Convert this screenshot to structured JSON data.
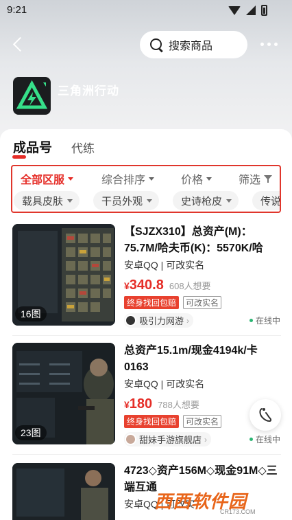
{
  "status_bar": {
    "time": "9:21"
  },
  "header": {
    "search_placeholder": "搜索商品",
    "game_title": "三角洲行动"
  },
  "tabs": [
    {
      "label": "成品号"
    },
    {
      "label": "代练"
    }
  ],
  "sort_bar": {
    "region": "全部区服",
    "sort": "综合排序",
    "price": "价格",
    "filter": "筛选"
  },
  "filter_chips": [
    "载具皮肤",
    "干员外观",
    "史诗枪皮",
    "传说枪"
  ],
  "listings": [
    {
      "title": "【SJZX310】总资产(M)：75.7M/哈夫币(K)：5570K/哈",
      "subtitle": "安卓QQ | 可改实名",
      "currency": "¥",
      "price": "340.8",
      "wants": "608人想要",
      "badge_guarantee": "终身找回包赔",
      "badge_realname": "可改实名",
      "shop": "吸引力网游",
      "status": "在线中",
      "image_count": "16图"
    },
    {
      "title": "总资产15.1m/现金4194k/卡0163",
      "subtitle": "安卓QQ | 可改实名",
      "currency": "¥",
      "price": "180",
      "wants": "788人想要",
      "badge_guarantee": "终身找回包赔",
      "badge_realname": "可改实名",
      "shop": "甜妹手游旗舰店",
      "status": "在线中",
      "image_count": "23图"
    },
    {
      "title": "4723◇资产156M◇现金91M◇三端互通",
      "subtitle": "安卓QQ | 可改实",
      "image_count": ""
    }
  ],
  "watermark": {
    "text": "西西软件园",
    "sub": "CR173.COM"
  },
  "colors": {
    "accent": "#e52d27",
    "online": "#2bb673",
    "highlight_box": "#e0362c"
  }
}
